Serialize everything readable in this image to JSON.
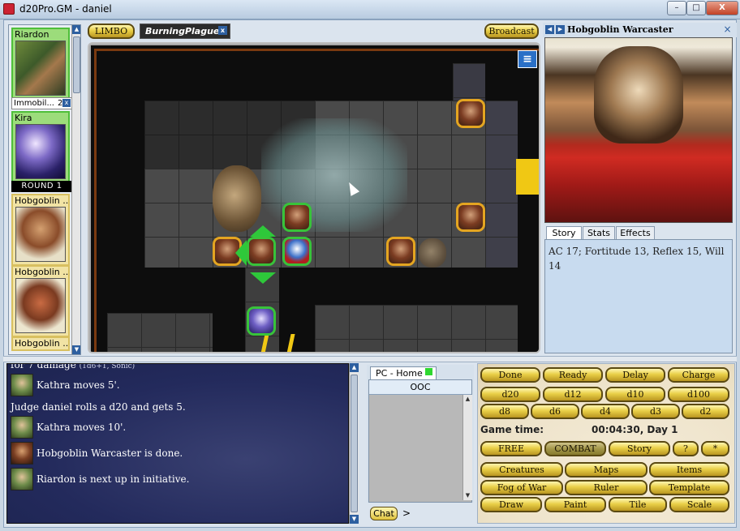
{
  "window": {
    "title": "d20Pro.GM - daniel",
    "min_label": "–",
    "max_label": "□",
    "close_label": "X"
  },
  "initiative": {
    "cards": [
      {
        "name": "Riardon",
        "side": "ally"
      },
      {
        "name": "Kira",
        "side": "ally"
      },
      {
        "name": "Hobgoblin ...",
        "side": "enemy"
      },
      {
        "name": "Hobgoblin ...",
        "side": "enemy"
      },
      {
        "name": "Hobgoblin ...",
        "side": "enemy"
      }
    ],
    "status_text": "Immobil...",
    "status_count": "2",
    "round_label": "ROUND 1"
  },
  "map_tabs": {
    "limbo_label": "LIMBO",
    "current_map": "BurningPlague",
    "broadcast_label": "Broadcast"
  },
  "selected": {
    "name": "Hobgoblin Warcaster",
    "tabs": [
      "Story",
      "Stats",
      "Effects"
    ],
    "active_tab": "Story",
    "story_text": "AC 17; Fortitude 13, Reflex 15, Will 14"
  },
  "chat": {
    "top_fragment": "for 7 damage",
    "top_fragment_small": "(1d6+1, Sonic)",
    "lines": [
      {
        "text": "Kathra moves 5'.",
        "avatar": "kathra"
      },
      {
        "text": "Judge daniel rolls a d20 and gets 5.",
        "avatar": ""
      },
      {
        "text": "Kathra moves 10'.",
        "avatar": "kathra"
      },
      {
        "text": "Hobgoblin Warcaster is done.",
        "avatar": "hobgoblin"
      },
      {
        "text": "Riardon is next up in initiative.",
        "avatar": "riardon"
      }
    ],
    "channel_tab": "PC - Home",
    "ooc_label": "OOC",
    "chat_button": "Chat",
    "prompt": ">"
  },
  "controls": {
    "row1": [
      "Done",
      "Ready",
      "Delay",
      "Charge"
    ],
    "dice_row1": [
      "d20",
      "d12",
      "d10",
      "d100"
    ],
    "dice_row2": [
      "d8",
      "d6",
      "d4",
      "d3",
      "d2"
    ],
    "game_time_label": "Game time:",
    "game_time_value": "00:04:30, Day 1",
    "mode_row": [
      "FREE",
      "COMBAT",
      "Story",
      "?",
      "*"
    ],
    "active_mode": "COMBAT",
    "tools_row1": [
      "Creatures",
      "Maps",
      "Items"
    ],
    "tools_row2": [
      "Fog of War",
      "Ruler",
      "Template"
    ],
    "tools_row3": [
      "Draw",
      "Paint",
      "Tile",
      "Scale"
    ]
  },
  "colors": {
    "ally_border": "#38c33a",
    "enemy_border": "#e4a521",
    "button_gold": "#e9cf47"
  }
}
